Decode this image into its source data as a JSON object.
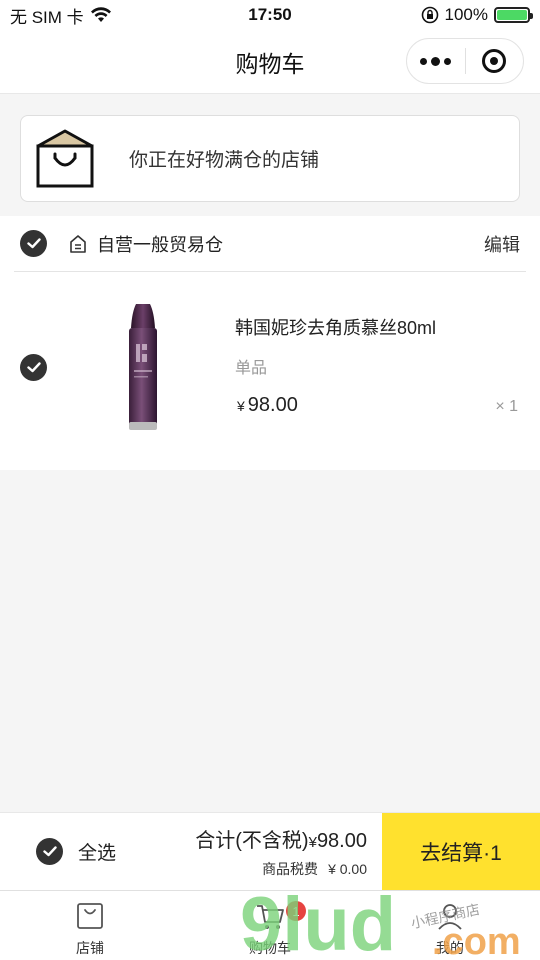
{
  "status_bar": {
    "carrier": "无 SIM 卡",
    "time": "17:50",
    "battery_percent": "100%",
    "battery_level": 1.0
  },
  "nav": {
    "title": "购物车",
    "more_icon": "more-dots-icon",
    "close_icon": "record-target-icon"
  },
  "store_banner": {
    "text": "你正在好物满仓的店铺",
    "icon": "shopping-bag-icon"
  },
  "cart": {
    "warehouse": {
      "name": "自营一般贸易仓",
      "edit_label": "编辑",
      "checked": true
    },
    "items": [
      {
        "name": "韩国妮珍去角质慕丝80ml",
        "spec": "单品",
        "currency": "¥",
        "price": "98.00",
        "qty": "× 1",
        "checked": true
      }
    ]
  },
  "checkout": {
    "select_all_label": "全选",
    "total_label": "合计(不含税)",
    "total_currency": "¥",
    "total_value": "98.00",
    "tax_label": "商品税费",
    "tax_value": "¥ 0.00",
    "pay_label": "去结算·1",
    "accent_color": "#ffe12e"
  },
  "tab_bar": {
    "tabs": [
      {
        "label": "店铺",
        "icon": "shopping-bag-icon"
      },
      {
        "label": "购物车",
        "icon": "cart-icon",
        "badge": "1"
      },
      {
        "label": "我的",
        "icon": "user-icon"
      }
    ]
  },
  "watermark": {
    "text": "9lud",
    "suffix": ".com",
    "handwriting": "小程序商店"
  }
}
